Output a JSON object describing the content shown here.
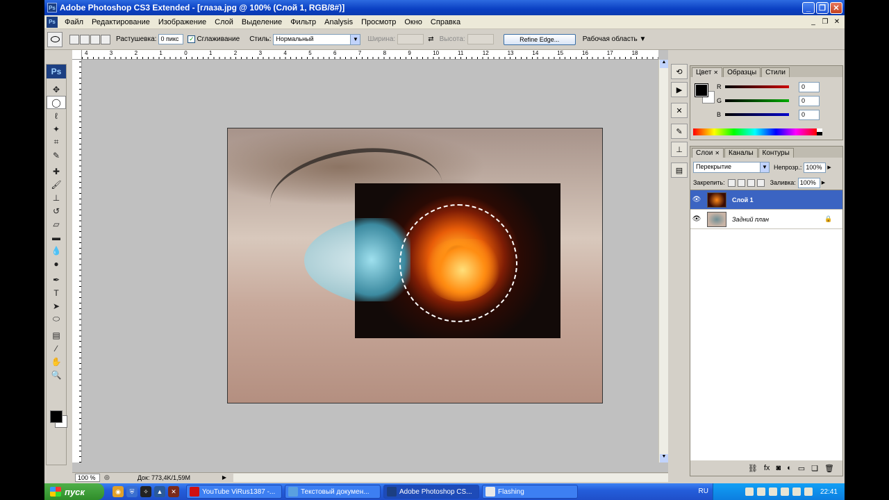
{
  "window": {
    "title": "Adobe Photoshop CS3 Extended - [глаза.jpg @ 100% (Слой 1, RGB/8#)]",
    "app_icon": "Ps",
    "buttons": [
      "_",
      "❐",
      "✕"
    ]
  },
  "menu": {
    "items": [
      "Файл",
      "Редактирование",
      "Изображение",
      "Слой",
      "Выделение",
      "Фильтр",
      "Analysis",
      "Просмотр",
      "Окно",
      "Справка"
    ],
    "doc_buttons": [
      "_",
      "❐",
      "✕"
    ]
  },
  "options": {
    "feather_label": "Растушевка:",
    "feather_value": "0 пикс",
    "antialias_label": "Сглаживание",
    "style_label": "Стиль:",
    "style_value": "Нормальный",
    "width_label": "Ширина:",
    "height_label": "Высота:",
    "refine_edge": "Refine Edge...",
    "workspace": "Рабочая область ▼"
  },
  "ruler": {
    "top_numbers": [
      "4",
      "3",
      "2",
      "1",
      "0",
      "1",
      "2",
      "3",
      "4",
      "5",
      "6",
      "7",
      "8",
      "9",
      "10",
      "11",
      "12",
      "13",
      "14",
      "15",
      "16",
      "17",
      "18"
    ]
  },
  "toolbox": {
    "logo": "Ps",
    "tools": [
      {
        "name": "move-tool-icon",
        "glyph": "✥"
      },
      {
        "name": "elliptical-marquee-icon",
        "glyph": "◯"
      },
      {
        "name": "lasso-icon",
        "glyph": "ℓ"
      },
      {
        "name": "magic-wand-icon",
        "glyph": "✦"
      },
      {
        "name": "crop-icon",
        "glyph": "⌗"
      },
      {
        "name": "slice-icon",
        "glyph": "✎"
      },
      {
        "name": "healing-brush-icon",
        "glyph": "✚"
      },
      {
        "name": "brush-icon",
        "glyph": "🖌"
      },
      {
        "name": "clone-stamp-icon",
        "glyph": "⊥"
      },
      {
        "name": "history-brush-icon",
        "glyph": "↺"
      },
      {
        "name": "eraser-icon",
        "glyph": "▱"
      },
      {
        "name": "gradient-icon",
        "glyph": "▬"
      },
      {
        "name": "blur-icon",
        "glyph": "💧"
      },
      {
        "name": "dodge-icon",
        "glyph": "●"
      },
      {
        "name": "pen-icon",
        "glyph": "✒"
      },
      {
        "name": "type-icon",
        "glyph": "T"
      },
      {
        "name": "path-selection-icon",
        "glyph": "➤"
      },
      {
        "name": "ellipse-shape-icon",
        "glyph": "⬭"
      },
      {
        "name": "notes-icon",
        "glyph": "▤"
      },
      {
        "name": "eyedropper-icon",
        "glyph": "⁄"
      },
      {
        "name": "hand-icon",
        "glyph": "✋"
      },
      {
        "name": "zoom-icon",
        "glyph": "🔍"
      }
    ]
  },
  "status": {
    "zoom": "100 %",
    "doc_info": "Док: 773,4K/1,59M"
  },
  "color_panel": {
    "tabs": [
      "Цвет",
      "Образцы",
      "Стили"
    ],
    "channels": [
      {
        "label": "R",
        "value": "0",
        "color": "#cc0000"
      },
      {
        "label": "G",
        "value": "0",
        "color": "#00aa00"
      },
      {
        "label": "B",
        "value": "0",
        "color": "#0000cc"
      }
    ]
  },
  "layers_panel": {
    "tabs": [
      "Слои",
      "Каналы",
      "Контуры"
    ],
    "blend_mode": "Перекрытие",
    "opacity_label": "Непрозр.:",
    "opacity_value": "100%",
    "lock_label": "Закрепить:",
    "fill_label": "Заливка:",
    "fill_value": "100%",
    "layers": [
      {
        "name": "Слой 1",
        "active": true
      },
      {
        "name": "Задний план",
        "active": false,
        "locked": true
      }
    ],
    "footer_icons": [
      "link-icon",
      "fx-icon",
      "mask-icon",
      "adjustment-icon",
      "group-icon",
      "new-layer-icon",
      "trash-icon"
    ]
  },
  "taskbar": {
    "start": "пуск",
    "tasks": [
      {
        "label": "YouTube ViRus1387 -...",
        "icon_color": "#d01010",
        "active": false
      },
      {
        "label": "Текстовый докумен...",
        "icon_color": "#5aa0e0",
        "active": false
      },
      {
        "label": "Adobe Photoshop CS...",
        "icon_color": "#1c3f82",
        "active": true
      },
      {
        "label": "Flashing",
        "icon_color": "#e8e8e8",
        "active": false
      }
    ],
    "lang": "RU",
    "clock": "22:41"
  }
}
